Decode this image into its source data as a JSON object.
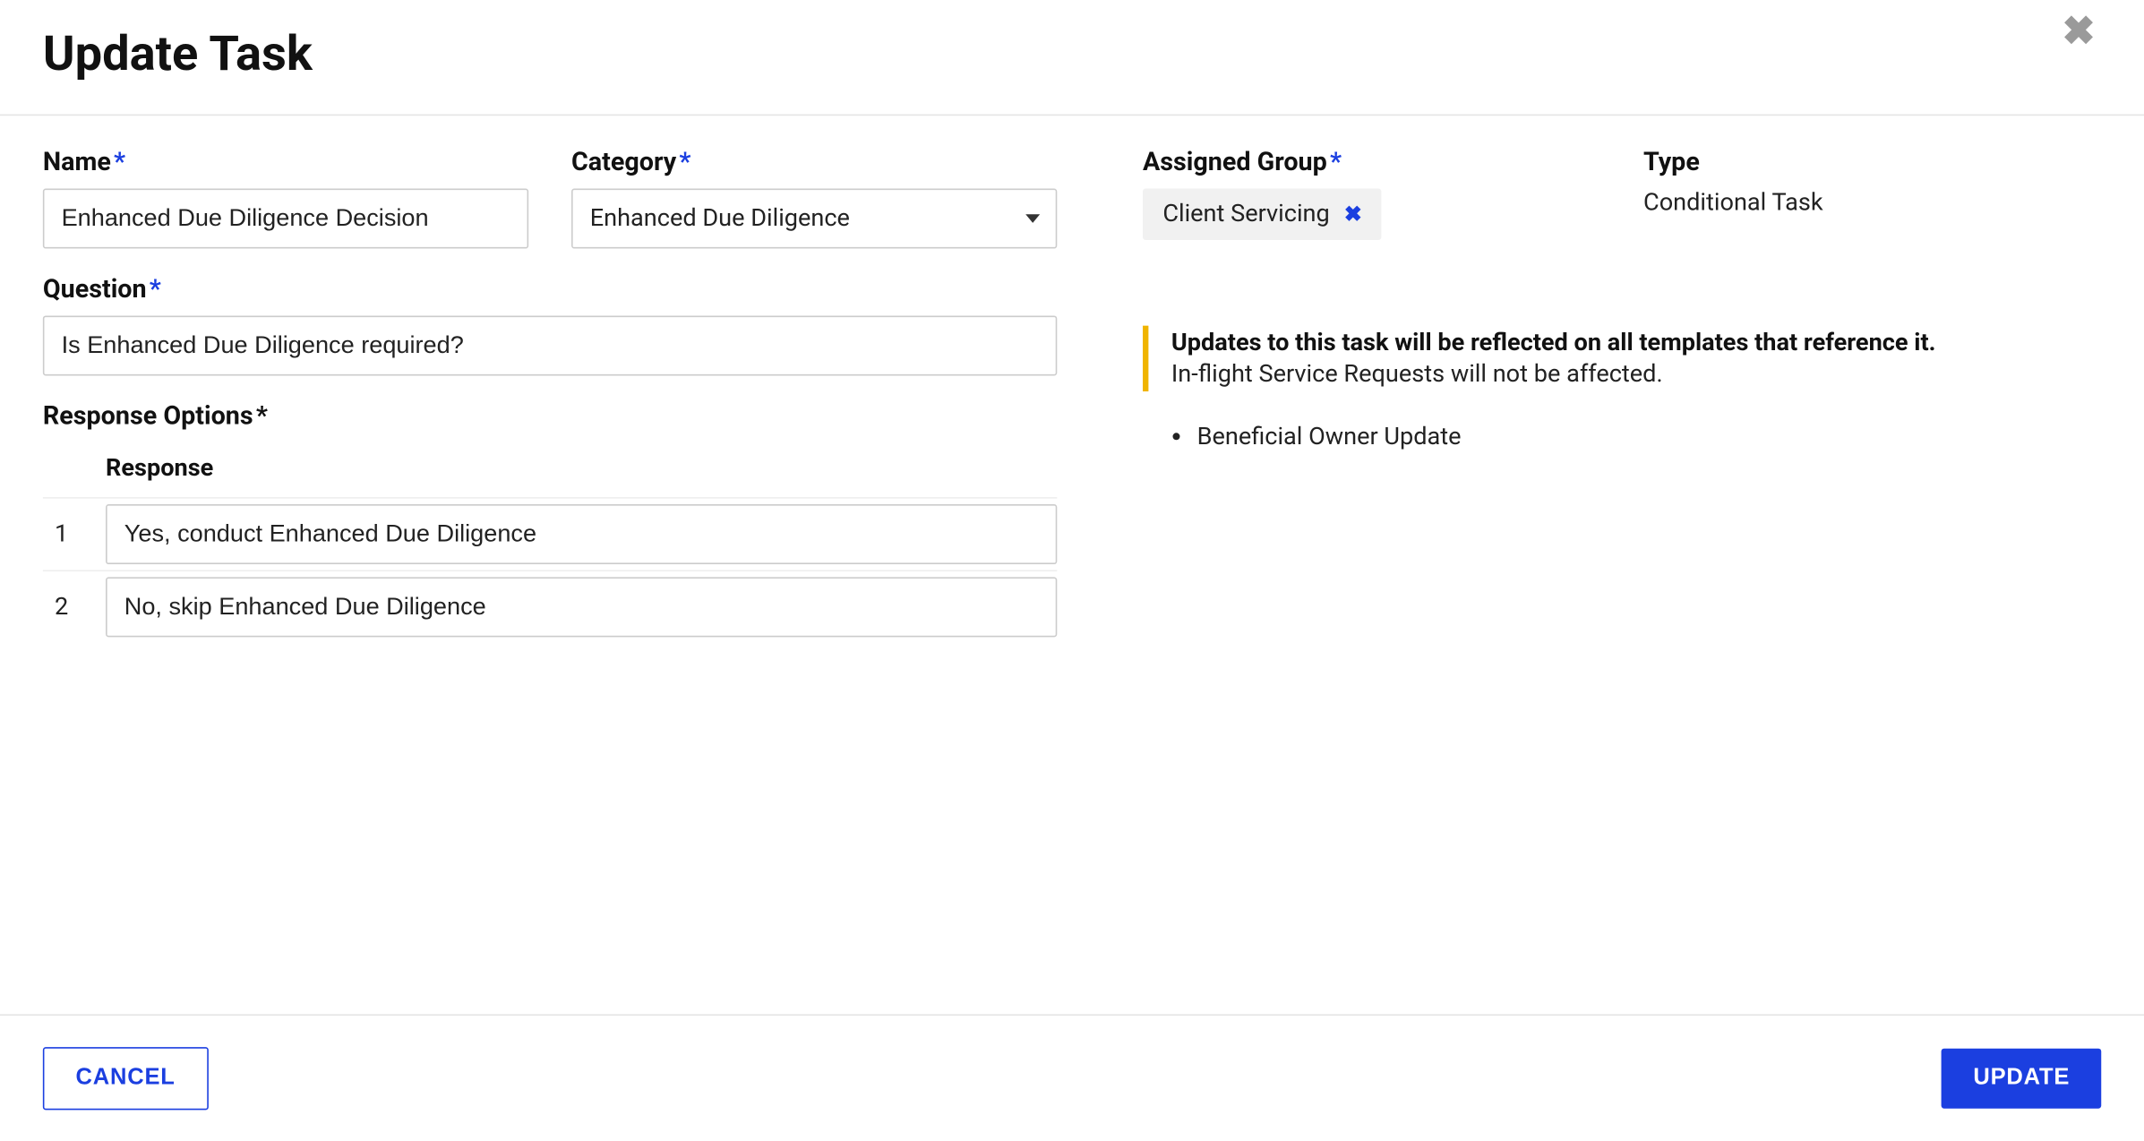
{
  "header": {
    "title": "Update Task"
  },
  "fields": {
    "name_label": "Name",
    "name_value": "Enhanced Due Diligence Decision",
    "category_label": "Category",
    "category_value": "Enhanced Due Diligence",
    "assigned_group_label": "Assigned Group",
    "assigned_group_value": "Client Servicing",
    "type_label": "Type",
    "type_value": "Conditional Task",
    "question_label": "Question",
    "question_value": "Is Enhanced Due Diligence required?",
    "response_options_label": "Response Options",
    "response_header": "Response",
    "responses": [
      {
        "num": "1",
        "text": "Yes, conduct Enhanced Due Diligence"
      },
      {
        "num": "2",
        "text": "No, skip Enhanced Due Diligence"
      }
    ]
  },
  "notice": {
    "bold": "Updates to this task will be reflected on all templates that reference it.",
    "text": "In-flight Service Requests will not be affected.",
    "items": [
      "Beneficial Owner Update"
    ]
  },
  "footer": {
    "cancel": "CANCEL",
    "update": "UPDATE"
  },
  "required_mark": "*"
}
